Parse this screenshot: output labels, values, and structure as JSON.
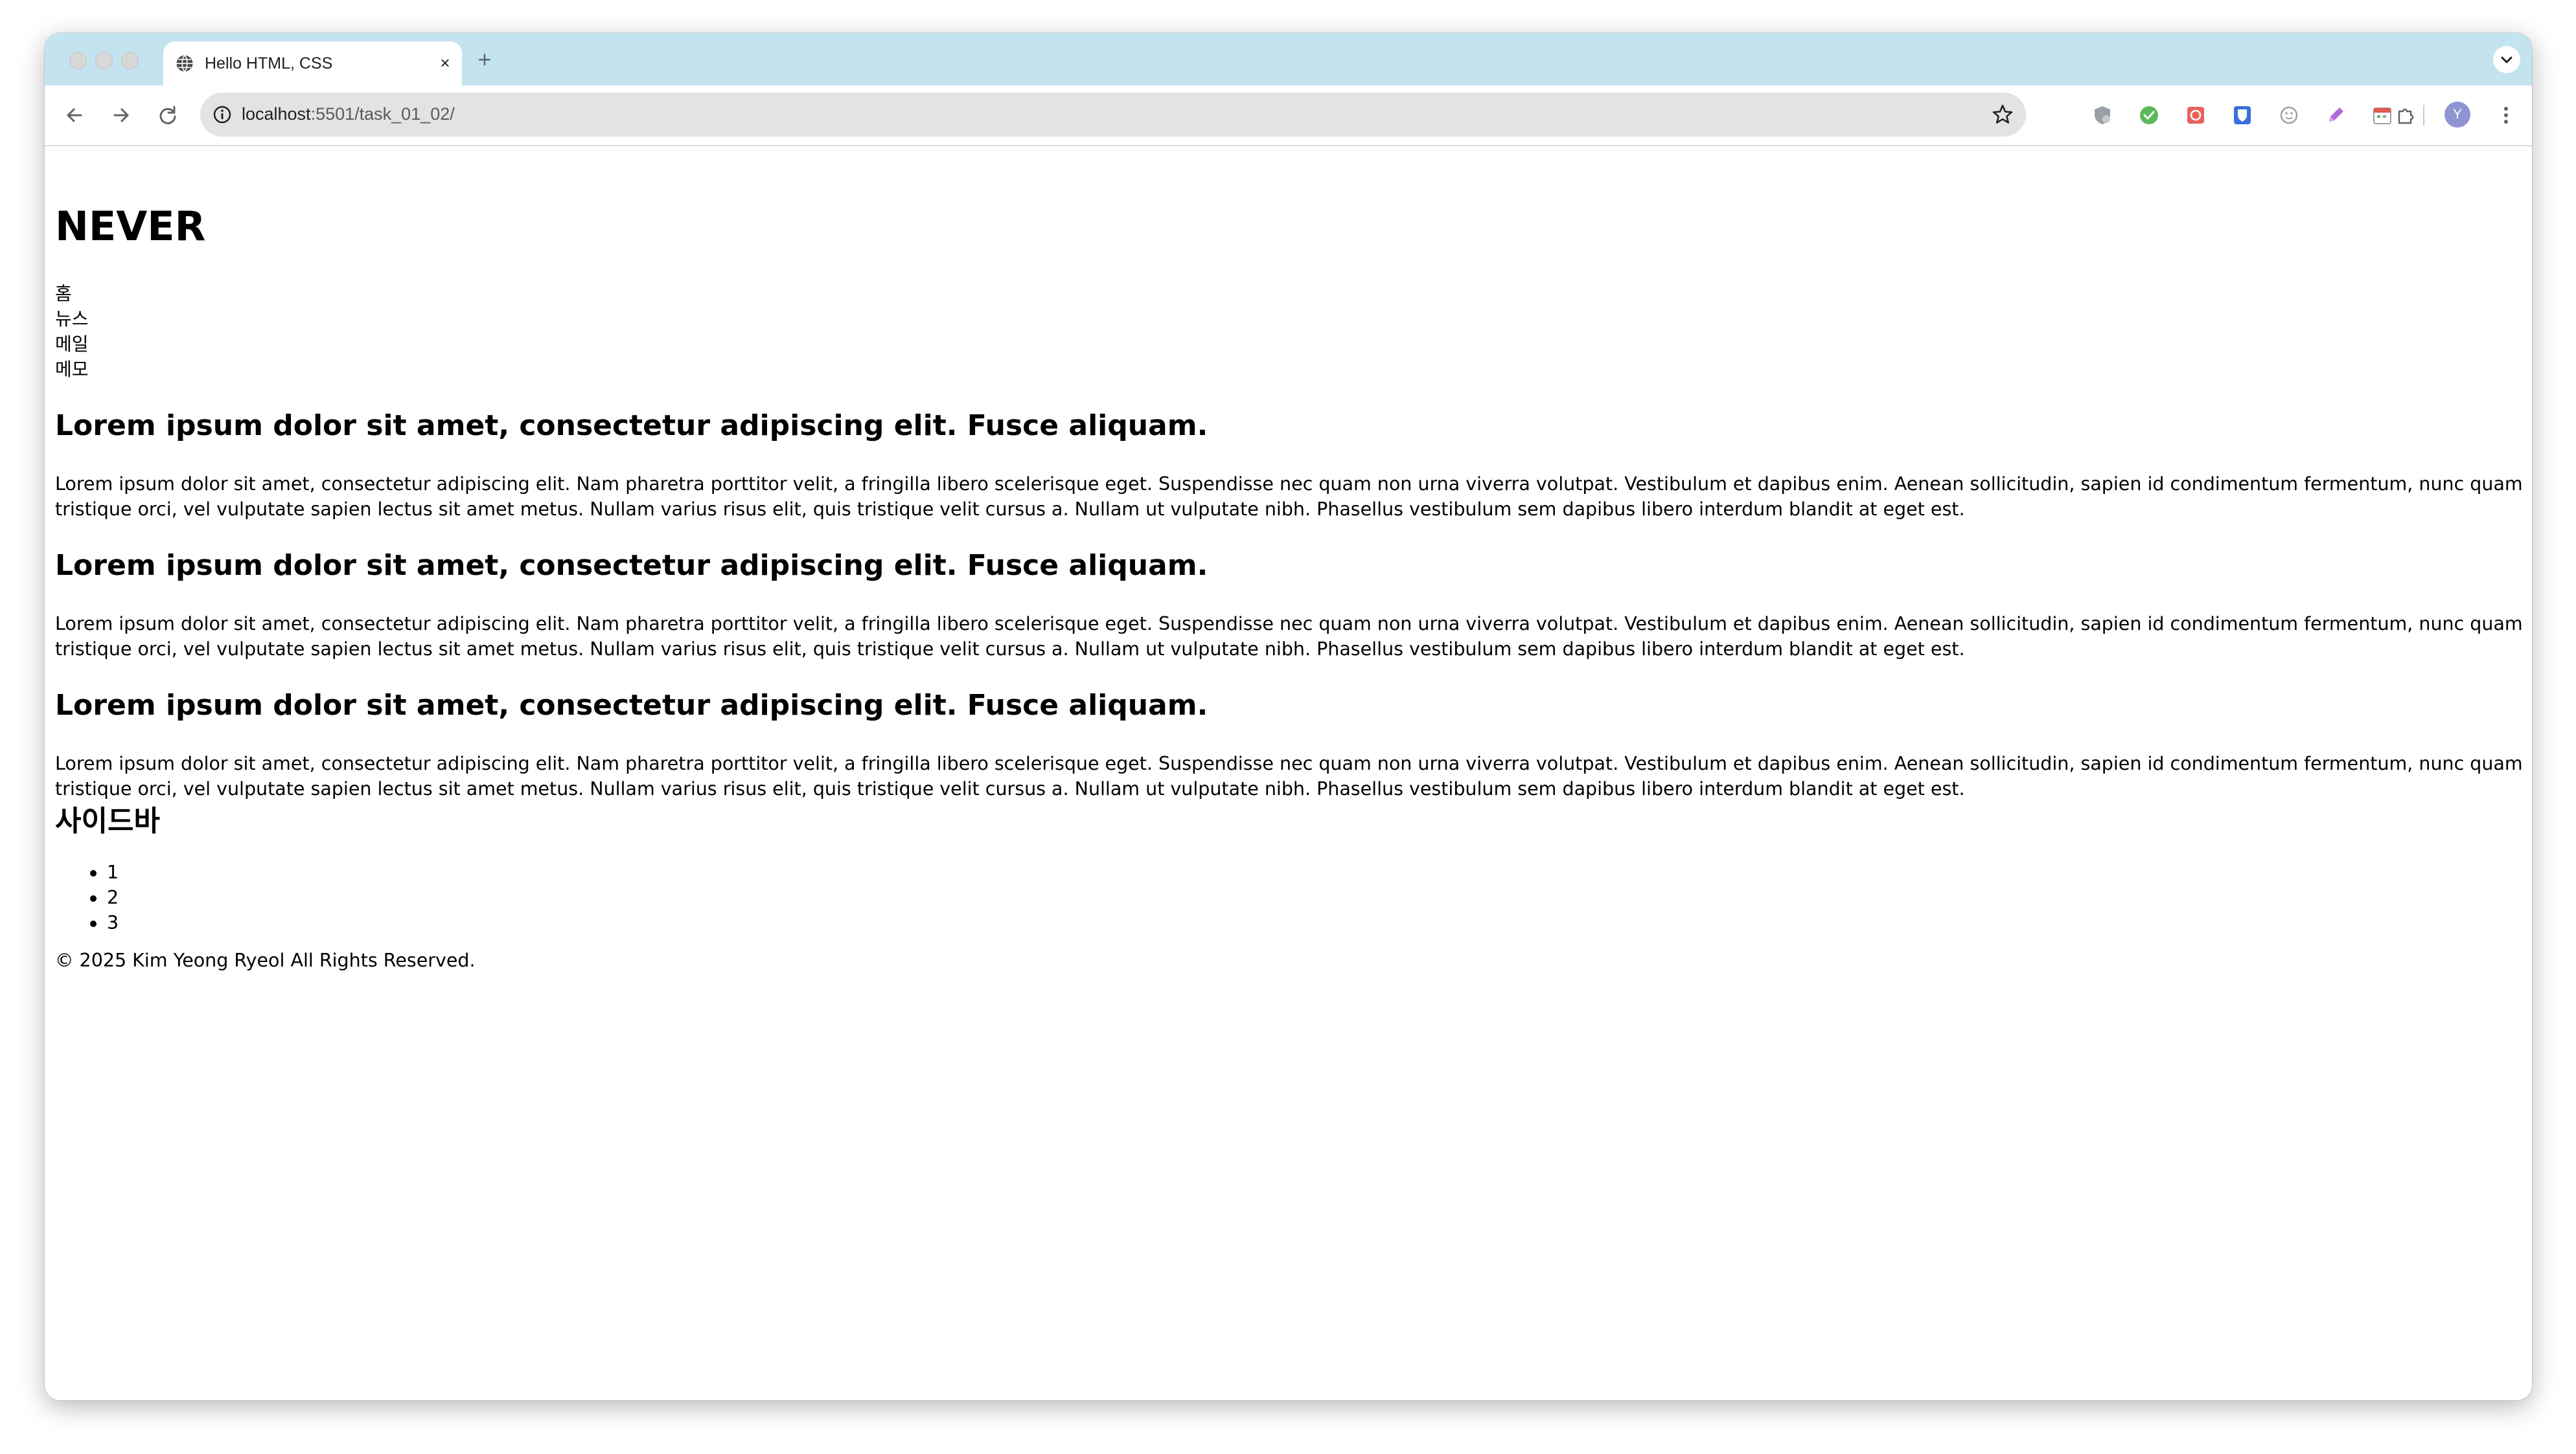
{
  "browser": {
    "tab_title": "Hello HTML, CSS",
    "tab_close": "×",
    "new_tab": "+",
    "url_host": "localhost",
    "url_path": ":5501/task_01_02/",
    "profile_initial": "Y",
    "colors": {
      "tabstrip": "#c3e3ef",
      "omnibox": "#e3e3e3",
      "avatar": "#8f95d3"
    },
    "icons": [
      "back-icon",
      "forward-icon",
      "reload-icon",
      "site-info-icon",
      "bookmark-star-icon",
      "extension-icons",
      "puzzle-icon",
      "menu-dots-icon"
    ]
  },
  "page": {
    "site_title": "NEVER",
    "nav": [
      "홈",
      "뉴스",
      "메일",
      "메모"
    ],
    "articles": [
      {
        "title": "Lorem ipsum dolor sit amet, consectetur adipiscing elit. Fusce aliquam.",
        "body": "Lorem ipsum dolor sit amet, consectetur adipiscing elit. Nam pharetra porttitor velit, a fringilla libero scelerisque eget. Suspendisse nec quam non urna viverra volutpat. Vestibulum et dapibus enim. Aenean sollicitudin, sapien id condimentum fermentum, nunc quam tristique orci, vel vulputate sapien lectus sit amet metus. Nullam varius risus elit, quis tristique velit cursus a. Nullam ut vulputate nibh. Phasellus vestibulum sem dapibus libero interdum blandit at eget est."
      },
      {
        "title": "Lorem ipsum dolor sit amet, consectetur adipiscing elit. Fusce aliquam.",
        "body": "Lorem ipsum dolor sit amet, consectetur adipiscing elit. Nam pharetra porttitor velit, a fringilla libero scelerisque eget. Suspendisse nec quam non urna viverra volutpat. Vestibulum et dapibus enim. Aenean sollicitudin, sapien id condimentum fermentum, nunc quam tristique orci, vel vulputate sapien lectus sit amet metus. Nullam varius risus elit, quis tristique velit cursus a. Nullam ut vulputate nibh. Phasellus vestibulum sem dapibus libero interdum blandit at eget est."
      },
      {
        "title": "Lorem ipsum dolor sit amet, consectetur adipiscing elit. Fusce aliquam.",
        "body": "Lorem ipsum dolor sit amet, consectetur adipiscing elit. Nam pharetra porttitor velit, a fringilla libero scelerisque eget. Suspendisse nec quam non urna viverra volutpat. Vestibulum et dapibus enim. Aenean sollicitudin, sapien id condimentum fermentum, nunc quam tristique orci, vel vulputate sapien lectus sit amet metus. Nullam varius risus elit, quis tristique velit cursus a. Nullam ut vulputate nibh. Phasellus vestibulum sem dapibus libero interdum blandit at eget est."
      }
    ],
    "sidebar_title": "사이드바",
    "sidebar_items": [
      "1",
      "2",
      "3"
    ],
    "footer": "© 2025 Kim Yeong Ryeol All Rights Reserved."
  }
}
